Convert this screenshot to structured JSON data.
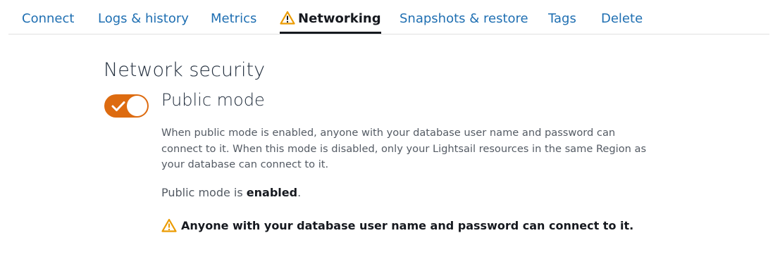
{
  "tabs": [
    {
      "label": "Connect",
      "active": false
    },
    {
      "label": "Logs & history",
      "active": false
    },
    {
      "label": "Metrics",
      "active": false
    },
    {
      "label": "Networking",
      "active": true,
      "icon": "warning-icon"
    },
    {
      "label": "Snapshots & restore",
      "active": false
    },
    {
      "label": "Tags",
      "active": false
    },
    {
      "label": "Delete",
      "active": false
    }
  ],
  "network_security": {
    "title": "Network security",
    "public_mode": {
      "label": "Public mode",
      "enabled": true,
      "toggle_color": "#dd6b10",
      "description": "When public mode is enabled, anyone with your database user name and password can connect to it. When this mode is disabled, only your Lightsail resources in the same Region as your database can connect to it.",
      "status_prefix": "Public mode is",
      "status_value": "enabled",
      "status_suffix": ".",
      "warning_icon": "warning-icon",
      "warning_color": "#eb9b00",
      "warning_text": "Anyone with your database user name and password can connect to it."
    }
  },
  "colors": {
    "link": "#1f6fb2",
    "accent": "#dd6b10",
    "warning": "#eb9b00"
  }
}
